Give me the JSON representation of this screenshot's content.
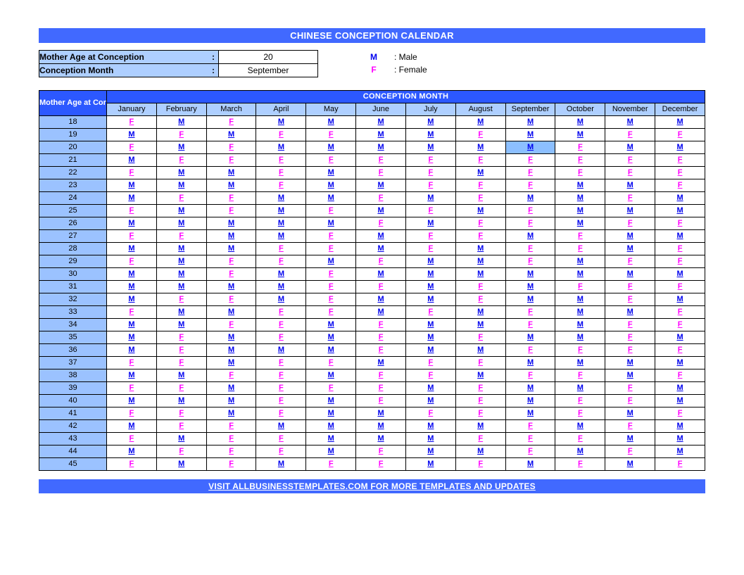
{
  "title": "CHINESE CONCEPTION CALENDAR",
  "inputs": {
    "age_label": "Mother Age at Conception",
    "age_value": "20",
    "month_label": "Conception Month",
    "month_value": "September"
  },
  "legend": {
    "m_symbol": "M",
    "m_text": ": Male",
    "f_symbol": "F",
    "f_text": ": Female"
  },
  "corner_label": "Mother Age at Conception",
  "big_header": "CONCEPTION MONTH",
  "months": [
    "January",
    "February",
    "March",
    "April",
    "May",
    "June",
    "July",
    "August",
    "September",
    "October",
    "November",
    "December"
  ],
  "highlight": {
    "age": 20,
    "month_index": 8
  },
  "rows": [
    {
      "age": 18,
      "v": [
        "F",
        "M",
        "F",
        "M",
        "M",
        "M",
        "M",
        "M",
        "M",
        "M",
        "M",
        "M"
      ]
    },
    {
      "age": 19,
      "v": [
        "M",
        "F",
        "M",
        "F",
        "F",
        "M",
        "M",
        "F",
        "M",
        "M",
        "F",
        "F"
      ]
    },
    {
      "age": 20,
      "v": [
        "F",
        "M",
        "F",
        "M",
        "M",
        "M",
        "M",
        "M",
        "M",
        "F",
        "M",
        "M"
      ]
    },
    {
      "age": 21,
      "v": [
        "M",
        "F",
        "F",
        "F",
        "F",
        "F",
        "F",
        "F",
        "F",
        "F",
        "F",
        "F"
      ]
    },
    {
      "age": 22,
      "v": [
        "F",
        "M",
        "M",
        "F",
        "M",
        "F",
        "F",
        "M",
        "F",
        "F",
        "F",
        "F"
      ]
    },
    {
      "age": 23,
      "v": [
        "M",
        "M",
        "M",
        "F",
        "M",
        "M",
        "F",
        "F",
        "F",
        "M",
        "M",
        "F"
      ]
    },
    {
      "age": 24,
      "v": [
        "M",
        "F",
        "F",
        "M",
        "M",
        "F",
        "M",
        "F",
        "M",
        "M",
        "F",
        "M"
      ]
    },
    {
      "age": 25,
      "v": [
        "F",
        "M",
        "F",
        "M",
        "F",
        "M",
        "F",
        "M",
        "F",
        "M",
        "M",
        "M"
      ]
    },
    {
      "age": 26,
      "v": [
        "M",
        "M",
        "M",
        "M",
        "M",
        "F",
        "M",
        "F",
        "F",
        "M",
        "F",
        "F"
      ]
    },
    {
      "age": 27,
      "v": [
        "F",
        "F",
        "M",
        "M",
        "F",
        "M",
        "F",
        "F",
        "M",
        "F",
        "M",
        "M"
      ]
    },
    {
      "age": 28,
      "v": [
        "M",
        "M",
        "M",
        "F",
        "F",
        "M",
        "F",
        "M",
        "F",
        "F",
        "M",
        "F"
      ]
    },
    {
      "age": 29,
      "v": [
        "F",
        "M",
        "F",
        "F",
        "M",
        "F",
        "M",
        "M",
        "F",
        "M",
        "F",
        "F"
      ]
    },
    {
      "age": 30,
      "v": [
        "M",
        "M",
        "F",
        "M",
        "F",
        "M",
        "M",
        "M",
        "M",
        "M",
        "M",
        "M"
      ]
    },
    {
      "age": 31,
      "v": [
        "M",
        "M",
        "M",
        "M",
        "F",
        "F",
        "M",
        "F",
        "M",
        "F",
        "F",
        "F"
      ]
    },
    {
      "age": 32,
      "v": [
        "M",
        "F",
        "F",
        "M",
        "F",
        "M",
        "M",
        "F",
        "M",
        "M",
        "F",
        "M"
      ]
    },
    {
      "age": 33,
      "v": [
        "F",
        "M",
        "M",
        "F",
        "F",
        "M",
        "F",
        "M",
        "F",
        "M",
        "M",
        "F"
      ]
    },
    {
      "age": 34,
      "v": [
        "M",
        "M",
        "F",
        "F",
        "M",
        "F",
        "M",
        "M",
        "F",
        "M",
        "F",
        "F"
      ]
    },
    {
      "age": 35,
      "v": [
        "M",
        "F",
        "M",
        "F",
        "M",
        "F",
        "M",
        "F",
        "M",
        "M",
        "F",
        "M"
      ]
    },
    {
      "age": 36,
      "v": [
        "M",
        "F",
        "M",
        "M",
        "M",
        "F",
        "M",
        "M",
        "F",
        "F",
        "F",
        "F"
      ]
    },
    {
      "age": 37,
      "v": [
        "F",
        "F",
        "M",
        "F",
        "F",
        "M",
        "F",
        "F",
        "M",
        "M",
        "M",
        "M"
      ]
    },
    {
      "age": 38,
      "v": [
        "M",
        "M",
        "F",
        "F",
        "M",
        "F",
        "F",
        "M",
        "F",
        "F",
        "M",
        "F"
      ]
    },
    {
      "age": 39,
      "v": [
        "F",
        "F",
        "M",
        "F",
        "F",
        "F",
        "M",
        "F",
        "M",
        "M",
        "F",
        "M"
      ]
    },
    {
      "age": 40,
      "v": [
        "M",
        "M",
        "M",
        "F",
        "M",
        "F",
        "M",
        "F",
        "M",
        "F",
        "F",
        "M"
      ]
    },
    {
      "age": 41,
      "v": [
        "F",
        "F",
        "M",
        "F",
        "M",
        "M",
        "F",
        "F",
        "M",
        "F",
        "M",
        "F"
      ]
    },
    {
      "age": 42,
      "v": [
        "M",
        "F",
        "F",
        "M",
        "M",
        "M",
        "M",
        "M",
        "F",
        "M",
        "F",
        "M"
      ]
    },
    {
      "age": 43,
      "v": [
        "F",
        "M",
        "F",
        "F",
        "M",
        "M",
        "M",
        "F",
        "F",
        "F",
        "M",
        "M"
      ]
    },
    {
      "age": 44,
      "v": [
        "M",
        "F",
        "F",
        "F",
        "M",
        "F",
        "M",
        "M",
        "F",
        "M",
        "F",
        "M"
      ]
    },
    {
      "age": 45,
      "v": [
        "F",
        "M",
        "F",
        "M",
        "F",
        "F",
        "M",
        "F",
        "M",
        "F",
        "M",
        "F"
      ]
    }
  ],
  "footer": "VISIT ALLBUSINESSTEMPLATES.COM FOR MORE TEMPLATES AND UPDATES"
}
